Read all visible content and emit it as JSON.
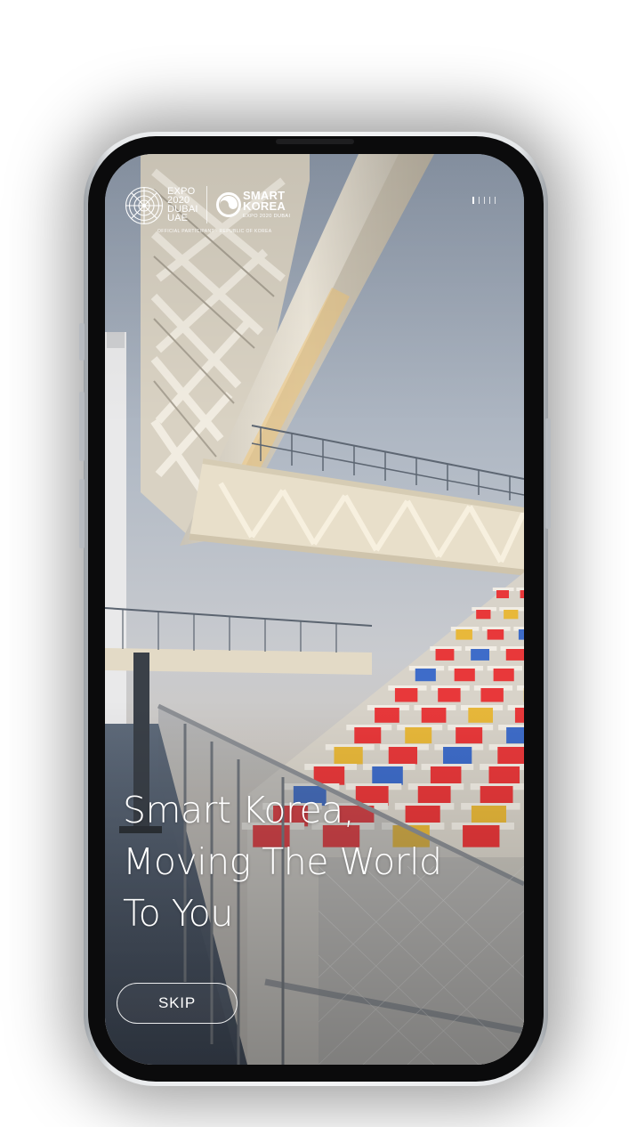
{
  "splash": {
    "logos": {
      "expo": {
        "icon": "expo-2020-dubai-emblem-icon",
        "lines": [
          "EXPO",
          "2020",
          "DUBAI",
          "UAE"
        ]
      },
      "smart_korea": {
        "icon": "smart-korea-taegeuk-icon",
        "name_lines": [
          "SMART",
          "KOREA"
        ],
        "subtitle": "EXPO 2020 DUBAI"
      },
      "participant_note": "OFFICIAL PARTICIPANT · REPUBLIC OF KOREA"
    },
    "pager": {
      "total": 5,
      "active_index": 0
    },
    "headline_lines": [
      "Smart Korea,",
      "Moving The World",
      "To You"
    ],
    "skip_label": "SKIP",
    "background_photo": "stadium-seating-and-steel-truss-photo"
  },
  "colors": {
    "text": "#ffffff",
    "seat_red": "#e8383a",
    "seat_yellow": "#e8b83a",
    "seat_blue": "#3e6cc9",
    "structure": "#ece6d8",
    "sky": "#b8c0ca",
    "device_body": "#0b0b0c"
  }
}
